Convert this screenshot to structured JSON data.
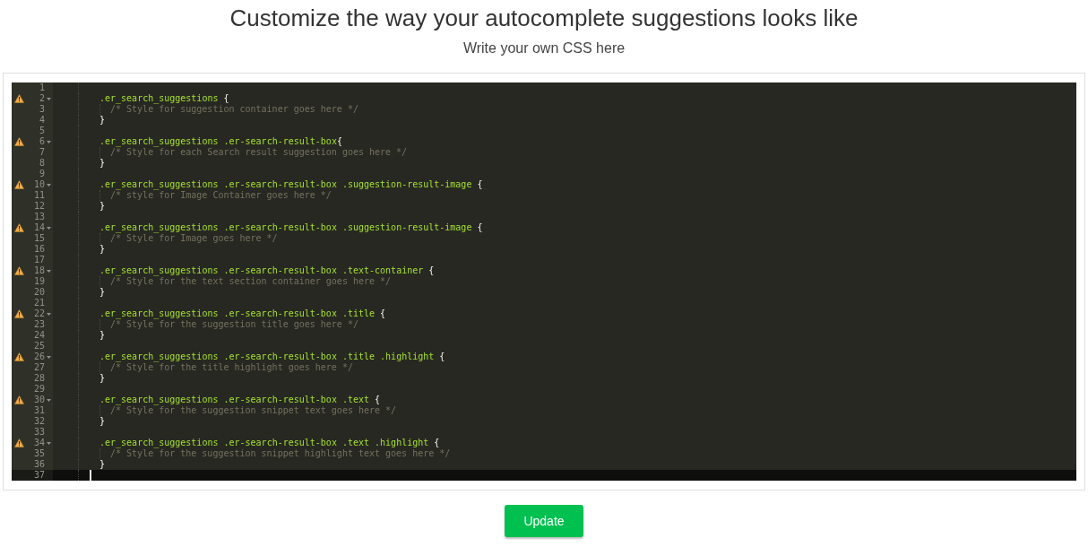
{
  "heading": "Customize the way your autocomplete suggestions looks like",
  "subheading": "Write your own CSS here",
  "editor": {
    "lines": [
      {
        "number": "1",
        "kind": "blank",
        "warning": false,
        "foldable": false,
        "active": false
      },
      {
        "number": "2",
        "kind": "selector",
        "selector": ".er_search_suggestions ",
        "brace": "{",
        "warning": true,
        "foldable": true,
        "active": false
      },
      {
        "number": "3",
        "kind": "comment",
        "text": "/* Style for suggestion container goes here */",
        "warning": false,
        "foldable": false,
        "active": false
      },
      {
        "number": "4",
        "kind": "close",
        "text": "}",
        "warning": false,
        "foldable": false,
        "active": false
      },
      {
        "number": "5",
        "kind": "blank",
        "warning": false,
        "foldable": false,
        "active": false
      },
      {
        "number": "6",
        "kind": "selector",
        "selector": ".er_search_suggestions .er-search-result-box",
        "brace": "{",
        "warning": true,
        "foldable": true,
        "active": false
      },
      {
        "number": "7",
        "kind": "comment",
        "text": "/* Style for each Search result suggestion goes here */",
        "warning": false,
        "foldable": false,
        "active": false
      },
      {
        "number": "8",
        "kind": "close",
        "text": "}",
        "warning": false,
        "foldable": false,
        "active": false
      },
      {
        "number": "9",
        "kind": "blank",
        "warning": false,
        "foldable": false,
        "active": false
      },
      {
        "number": "10",
        "kind": "selector",
        "selector": ".er_search_suggestions .er-search-result-box .suggestion-result-image ",
        "brace": "{",
        "warning": true,
        "foldable": true,
        "active": false
      },
      {
        "number": "11",
        "kind": "comment",
        "text": "/* style for Image Container goes here */",
        "warning": false,
        "foldable": false,
        "active": false
      },
      {
        "number": "12",
        "kind": "close",
        "text": "}",
        "warning": false,
        "foldable": false,
        "active": false
      },
      {
        "number": "13",
        "kind": "blank",
        "warning": false,
        "foldable": false,
        "active": false
      },
      {
        "number": "14",
        "kind": "selector",
        "selector": ".er_search_suggestions .er-search-result-box .suggestion-result-image ",
        "brace": "{",
        "warning": true,
        "foldable": true,
        "active": false
      },
      {
        "number": "15",
        "kind": "comment",
        "text": "/* Style for Image goes here */",
        "warning": false,
        "foldable": false,
        "active": false
      },
      {
        "number": "16",
        "kind": "close",
        "text": "}",
        "warning": false,
        "foldable": false,
        "active": false
      },
      {
        "number": "17",
        "kind": "blank",
        "warning": false,
        "foldable": false,
        "active": false
      },
      {
        "number": "18",
        "kind": "selector",
        "selector": ".er_search_suggestions .er-search-result-box .text-container ",
        "brace": "{",
        "warning": true,
        "foldable": true,
        "active": false
      },
      {
        "number": "19",
        "kind": "comment",
        "text": "/* Style for the text section container goes here */",
        "warning": false,
        "foldable": false,
        "active": false
      },
      {
        "number": "20",
        "kind": "close",
        "text": "}",
        "warning": false,
        "foldable": false,
        "active": false
      },
      {
        "number": "21",
        "kind": "blank",
        "warning": false,
        "foldable": false,
        "active": false
      },
      {
        "number": "22",
        "kind": "selector",
        "selector": ".er_search_suggestions .er-search-result-box .title ",
        "brace": "{",
        "warning": true,
        "foldable": true,
        "active": false
      },
      {
        "number": "23",
        "kind": "comment",
        "text": "/* Style for the suggestion title goes here */",
        "warning": false,
        "foldable": false,
        "active": false
      },
      {
        "number": "24",
        "kind": "close",
        "text": "}",
        "warning": false,
        "foldable": false,
        "active": false
      },
      {
        "number": "25",
        "kind": "blank",
        "warning": false,
        "foldable": false,
        "active": false
      },
      {
        "number": "26",
        "kind": "selector",
        "selector": ".er_search_suggestions .er-search-result-box .title .highlight ",
        "brace": "{",
        "warning": true,
        "foldable": true,
        "active": false
      },
      {
        "number": "27",
        "kind": "comment",
        "text": "/* Style for the title highlight goes here */",
        "warning": false,
        "foldable": false,
        "active": false
      },
      {
        "number": "28",
        "kind": "close",
        "text": "}",
        "warning": false,
        "foldable": false,
        "active": false
      },
      {
        "number": "29",
        "kind": "blank",
        "warning": false,
        "foldable": false,
        "active": false
      },
      {
        "number": "30",
        "kind": "selector",
        "selector": ".er_search_suggestions .er-search-result-box .text ",
        "brace": "{",
        "warning": true,
        "foldable": true,
        "active": false
      },
      {
        "number": "31",
        "kind": "comment",
        "text": "/* Style for the suggestion snippet text goes here */",
        "warning": false,
        "foldable": false,
        "active": false
      },
      {
        "number": "32",
        "kind": "close",
        "text": "}",
        "warning": false,
        "foldable": false,
        "active": false
      },
      {
        "number": "33",
        "kind": "blank",
        "warning": false,
        "foldable": false,
        "active": false
      },
      {
        "number": "34",
        "kind": "selector",
        "selector": ".er_search_suggestions .er-search-result-box .text .highlight ",
        "brace": "{",
        "warning": true,
        "foldable": true,
        "active": false
      },
      {
        "number": "35",
        "kind": "comment",
        "text": "/* Style for the suggestion snippet highlight text goes here */",
        "warning": false,
        "foldable": false,
        "active": false
      },
      {
        "number": "36",
        "kind": "close",
        "text": "}",
        "warning": false,
        "foldable": false,
        "active": false
      },
      {
        "number": "37",
        "kind": "blank",
        "warning": false,
        "foldable": false,
        "active": true
      }
    ]
  },
  "update_button": "Update"
}
